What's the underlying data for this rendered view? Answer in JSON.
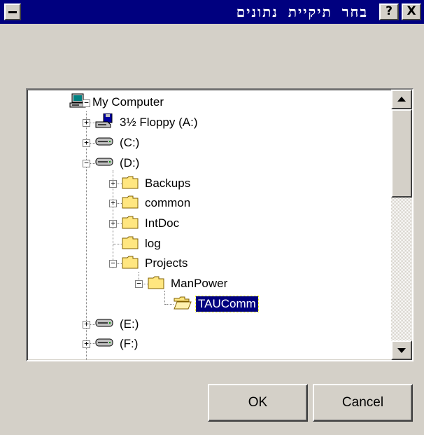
{
  "window": {
    "title": "בחר תיקיית נתונים"
  },
  "titlebar": {
    "help_label": "?",
    "close_label": "X"
  },
  "tree": {
    "items": [
      {
        "label": "My Computer",
        "icon": "computer-icon",
        "state": "collapse"
      },
      {
        "label": "3½ Floppy (A:)",
        "icon": "floppy-drive-icon",
        "state": "expand"
      },
      {
        "label": "(C:)",
        "icon": "hard-drive-icon",
        "state": "expand"
      },
      {
        "label": "(D:)",
        "icon": "hard-drive-icon",
        "state": "collapse"
      },
      {
        "label": "Backups",
        "icon": "folder-icon",
        "state": "expand"
      },
      {
        "label": "common",
        "icon": "folder-icon",
        "state": "expand"
      },
      {
        "label": "IntDoc",
        "icon": "folder-icon",
        "state": "expand"
      },
      {
        "label": "log",
        "icon": "folder-icon",
        "state": "none"
      },
      {
        "label": "Projects",
        "icon": "folder-icon",
        "state": "collapse"
      },
      {
        "label": "ManPower",
        "icon": "folder-icon",
        "state": "collapse"
      },
      {
        "label": "TAUComm",
        "icon": "open-folder-icon",
        "state": "none",
        "selected": true
      },
      {
        "label": "(E:)",
        "icon": "hard-drive-icon",
        "state": "expand"
      },
      {
        "label": "(F:)",
        "icon": "hard-drive-icon",
        "state": "expand"
      }
    ]
  },
  "buttons": {
    "ok_label": "OK",
    "cancel_label": "Cancel"
  },
  "colors": {
    "title_bg": "#00007f",
    "window_bg": "#d4d0c8",
    "folder": "#ffe680",
    "selection": "#00007f"
  }
}
